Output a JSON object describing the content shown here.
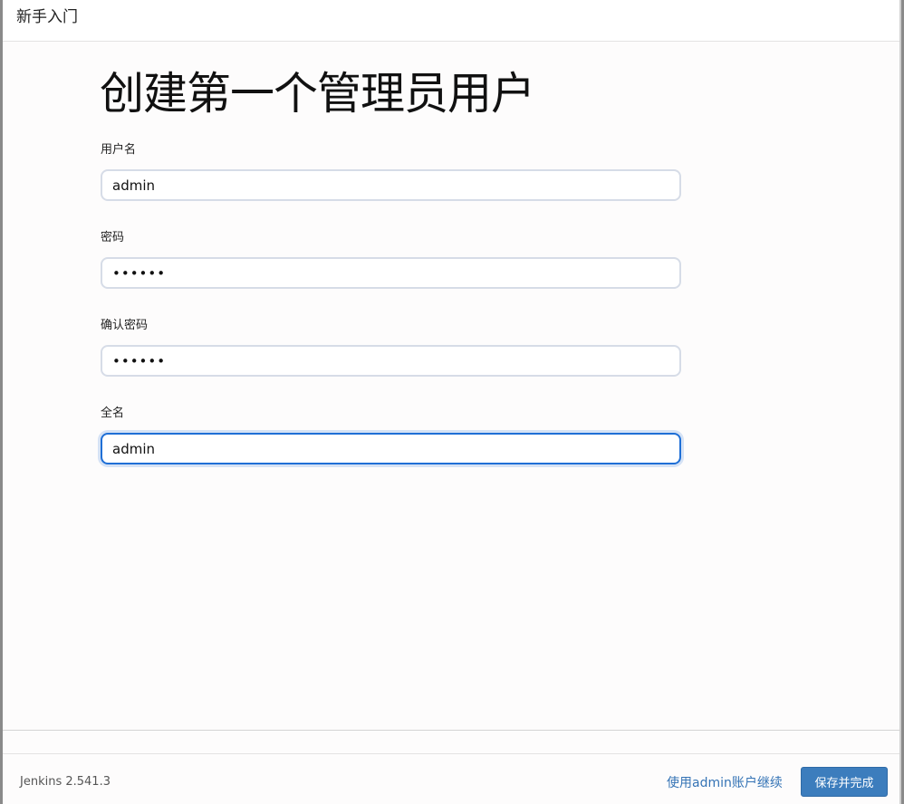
{
  "header": {
    "title": "新手入门"
  },
  "main": {
    "title": "创建第一个管理员用户",
    "fields": {
      "username": {
        "label": "用户名",
        "value": "admin"
      },
      "password": {
        "label": "密码",
        "value": "••••••"
      },
      "confirm_password": {
        "label": "确认密码",
        "value": "••••••"
      },
      "fullname": {
        "label": "全名",
        "value": "admin"
      }
    }
  },
  "footer": {
    "version": "Jenkins 2.541.3",
    "continue_link": "使用admin账户继续",
    "save_button": "保存并完成"
  },
  "colors": {
    "accent": "#3c7dbd",
    "link": "#3473b5",
    "focus_border": "#1f6fd6"
  }
}
